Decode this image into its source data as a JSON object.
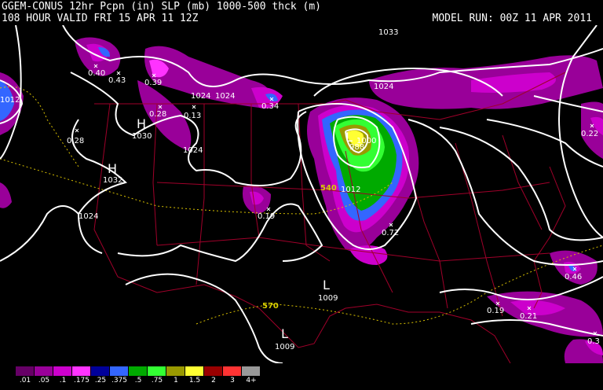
{
  "header": {
    "title": "GGEM-CONUS 12hr Pcpn (in) SLP (mb) 1000-500 thck (m)",
    "valid": "108 HOUR VALID FRI 15 APR 11 12Z",
    "model_run": "MODEL RUN: 00Z 11 APR 2011"
  },
  "colors": {
    "isobar": "#ffffff",
    "thickness": "#d8c000",
    "borders": "#a0002a",
    "background": "#000000"
  },
  "pressure_labels": [
    "1033",
    "1024",
    "1012",
    "1030",
    "1032",
    "1024",
    "1024",
    "1024",
    "1024",
    "1012",
    "1009",
    "1009",
    "1000",
    "988"
  ],
  "pressure_centers": {
    "high1": "H",
    "high2": "H",
    "low1": "L",
    "low2": "L",
    "low3": "L"
  },
  "thickness_labels": [
    "540",
    "570"
  ],
  "precip_max_labels": [
    "0.40",
    "0.43",
    "0.39",
    "0.28",
    "0.13",
    "0.34",
    "0.28",
    "0.19",
    "0.72",
    "0.22",
    "0.46",
    "0.19",
    "0.21",
    "0.3"
  ],
  "legend": [
    {
      "label": ".01",
      "color": "#660066"
    },
    {
      "label": ".05",
      "color": "#990099"
    },
    {
      "label": ".1",
      "color": "#cc00cc"
    },
    {
      "label": ".175",
      "color": "#ff33ff"
    },
    {
      "label": ".25",
      "color": "#000099"
    },
    {
      "label": ".375",
      "color": "#3366ff"
    },
    {
      "label": ".5",
      "color": "#00aa00"
    },
    {
      "label": ".75",
      "color": "#33ff33"
    },
    {
      "label": "1",
      "color": "#999900"
    },
    {
      "label": "1.5",
      "color": "#ffff33"
    },
    {
      "label": "2",
      "color": "#990000"
    },
    {
      "label": "3",
      "color": "#ff3333"
    },
    {
      "label": "4+",
      "color": "#999999"
    }
  ]
}
